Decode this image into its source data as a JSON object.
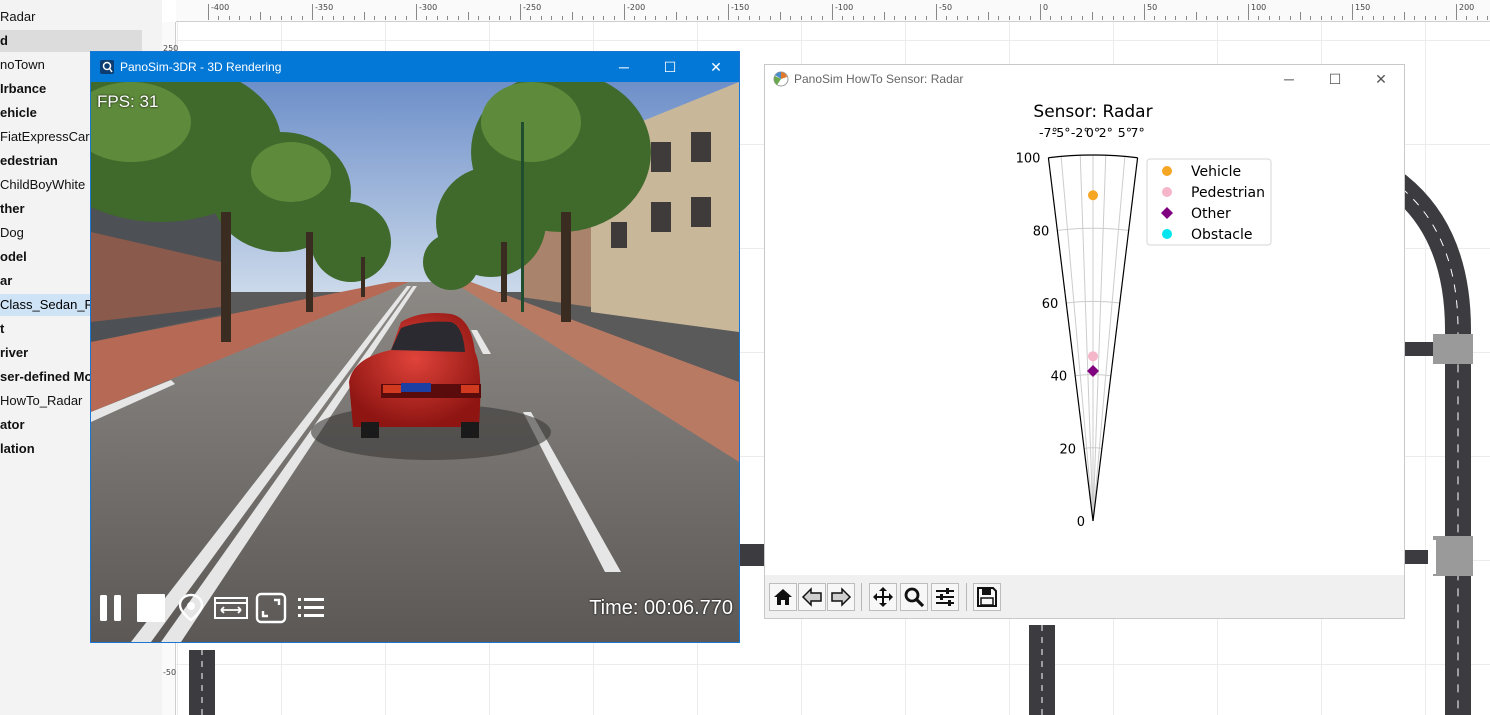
{
  "tree": {
    "items": [
      {
        "label": "Radar",
        "bold": false
      },
      {
        "label": "d",
        "bold": true
      },
      {
        "label": "noTown",
        "bold": false
      },
      {
        "label": "Irbance",
        "bold": true
      },
      {
        "label": "ehicle",
        "bold": true
      },
      {
        "label": "FiatExpressCar",
        "bold": false
      },
      {
        "label": "edestrian",
        "bold": true
      },
      {
        "label": "ChildBoyWhite",
        "bold": false
      },
      {
        "label": "ther",
        "bold": true
      },
      {
        "label": "Dog",
        "bold": false
      },
      {
        "label": "odel",
        "bold": true
      },
      {
        "label": "ar",
        "bold": true
      },
      {
        "label": "Class_Sedan_Rad",
        "bold": false
      },
      {
        "label": "t",
        "bold": true
      },
      {
        "label": "river",
        "bold": true
      },
      {
        "label": "ser-defined Mo",
        "bold": true
      },
      {
        "label": "HowTo_Radar",
        "bold": false
      },
      {
        "label": "ator",
        "bold": true
      },
      {
        "label": "lation",
        "bold": true
      }
    ]
  },
  "ruler": {
    "top_labels": [
      "-400",
      "-350",
      "-300",
      "-250",
      "-200",
      "-150",
      "-100",
      "-50",
      "0",
      "50",
      "100",
      "150",
      "200"
    ],
    "left_labels": [
      "250",
      "-50"
    ]
  },
  "render_window": {
    "title": "PanoSim-3DR - 3D Rendering",
    "fps": "FPS: 31",
    "time": "Time: 00:06.770",
    "minimize": "─",
    "maximize": "☐",
    "close": "✕",
    "plate": "PANOSIM"
  },
  "radar_window": {
    "title": "PanoSim HowTo Sensor: Radar",
    "minimize": "─",
    "maximize": "☐",
    "close": "✕"
  },
  "chart_data": {
    "type": "scatter",
    "projection": "polar-fan",
    "title": "Sensor: Radar",
    "angle_ticks": [
      "-7°",
      "-5°",
      "-2°",
      "0°",
      "2°",
      "5°",
      "7°"
    ],
    "angle_range_deg": [
      -7,
      7
    ],
    "range_ticks": [
      0,
      20,
      40,
      60,
      80,
      100
    ],
    "range_limit": [
      0,
      100
    ],
    "grid": true,
    "legend_position": "top-right",
    "series": [
      {
        "name": "Vehicle",
        "marker": "circle",
        "color": "#f5a623",
        "points": [
          {
            "angle_deg": 0.0,
            "range": 89
          }
        ]
      },
      {
        "name": "Pedestrian",
        "marker": "circle",
        "color": "#f4b6c8",
        "points": [
          {
            "angle_deg": 0.0,
            "range": 45
          }
        ]
      },
      {
        "name": "Other",
        "marker": "diamond",
        "color": "#800080",
        "points": [
          {
            "angle_deg": 0.0,
            "range": 41
          }
        ]
      },
      {
        "name": "Obstacle",
        "marker": "circle",
        "color": "#00e5ee",
        "points": []
      }
    ]
  }
}
